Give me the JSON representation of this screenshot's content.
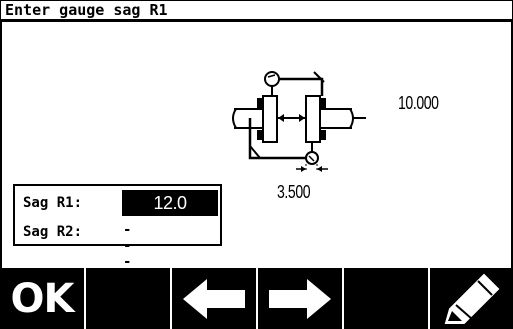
{
  "title": "Enter gauge sag R1",
  "diagram": {
    "distance_value": "10.000",
    "offset_value": "3.500"
  },
  "sag_panel": {
    "r1_label": "Sag R1:",
    "r1_value": "12.0",
    "r2_label": "Sag R2:",
    "r2_value": "----"
  },
  "toolbar": {
    "ok_label": "OK",
    "buttons": [
      {
        "icon": "ok"
      },
      {
        "icon": "blank"
      },
      {
        "icon": "arrow-left-icon"
      },
      {
        "icon": "arrow-right-icon"
      },
      {
        "icon": "blank"
      },
      {
        "icon": "pencil-icon"
      }
    ]
  }
}
